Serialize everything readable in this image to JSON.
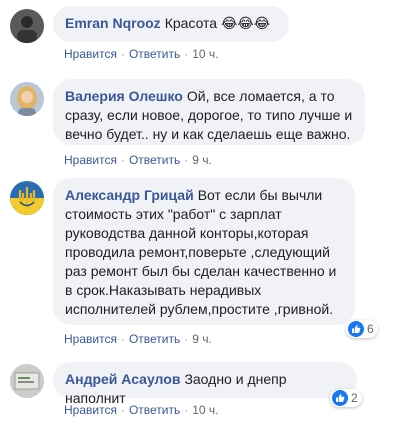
{
  "actions": {
    "like": "Нравится",
    "reply": "Ответить",
    "separator": "·"
  },
  "comments": [
    {
      "author": "Emran Nqrooz",
      "text": "Красота 😂😂😂",
      "time": "10 ч.",
      "avatar": "avatar-dark-person"
    },
    {
      "author": "Валерия Олешко",
      "text": "Ой, все ломается, а то сразу, если новое, дорогое, то типо лучше и вечно будет.. ну и как сделаешь еще важно.",
      "time": "9 ч.",
      "avatar": "avatar-woman"
    },
    {
      "author": "Александр Грицай",
      "text": "Вот если бы вычли стоимость этих \"работ\" с зарплат руководства данной конторы,которая проводила ремонт,поверьте ,следующий раз ремонт был бы сделан качественно и в срок.Наказывать нерадивых исполнителей рублем,простите ,гривной.",
      "time": "9 ч.",
      "avatar": "avatar-trident",
      "reactions": "6"
    },
    {
      "author": "Андрей Асаулов",
      "text": "Заодно и днепр наполнит",
      "time": "10 ч.",
      "avatar": "avatar-screen",
      "reactions": "2"
    }
  ],
  "colors": {
    "author": "#385898",
    "bubble": "#f0f2f5",
    "like": "#1877f2"
  }
}
